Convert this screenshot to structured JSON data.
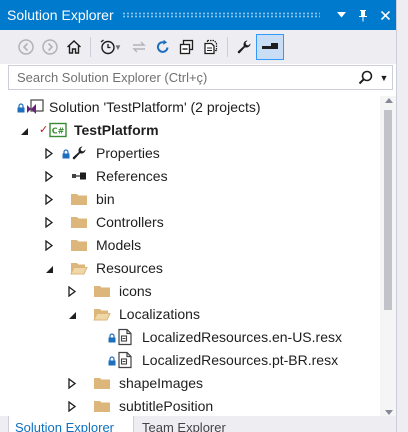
{
  "window": {
    "title": "Solution Explorer"
  },
  "title_buttons": {
    "dropdown_icon": "dropdown-arrow",
    "pin_icon": "pin",
    "close_icon": "close"
  },
  "toolbar": {
    "buttons": [
      "back",
      "forward",
      "home",
      "pending-changes-filter",
      "sync-with-active-document",
      "refresh",
      "collapse-all",
      "show-all-files",
      "properties",
      "preview-selected-items"
    ]
  },
  "search": {
    "placeholder": "Search Solution Explorer (Ctrl+ç)",
    "value": ""
  },
  "tree": {
    "solution": {
      "label": "Solution 'TestPlatform' (2 projects)"
    },
    "project": {
      "label": "TestPlatform"
    },
    "properties": {
      "label": "Properties"
    },
    "references": {
      "label": "References"
    },
    "bin": {
      "label": "bin"
    },
    "controllers": {
      "label": "Controllers"
    },
    "models": {
      "label": "Models"
    },
    "resources": {
      "label": "Resources"
    },
    "icons": {
      "label": "icons"
    },
    "localizations": {
      "label": "Localizations"
    },
    "resx_en": {
      "label": "LocalizedResources.en-US.resx"
    },
    "resx_pt": {
      "label": "LocalizedResources.pt-BR.resx"
    },
    "shapeimages": {
      "label": "shapeImages"
    },
    "subtitleposition": {
      "label": "subtitlePosition"
    }
  },
  "tabs": {
    "active": "Solution Explorer",
    "inactive": "Team Explorer"
  },
  "colors": {
    "accent": "#007acc",
    "folder": "#dcb67a",
    "csharp": "#388a34",
    "vs_purple": "#68217a",
    "lock": "#1e6fbd",
    "check": "#c21818"
  }
}
